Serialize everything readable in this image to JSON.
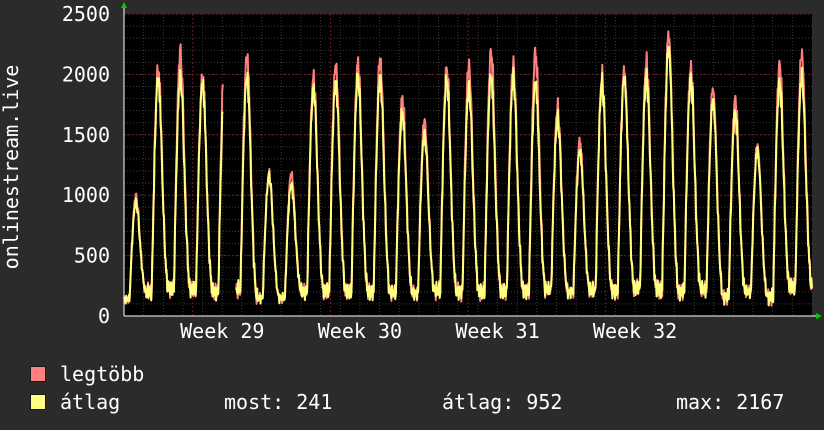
{
  "chart_data": {
    "type": "line",
    "ylabel": "onlinestream.live",
    "ylim": [
      0,
      2500
    ],
    "yticks": [
      0,
      500,
      1000,
      1500,
      2000,
      2500
    ],
    "x_range_days": [
      0,
      35
    ],
    "week_labels": [
      {
        "label": "Week 29",
        "day": 5
      },
      {
        "label": "Week 30",
        "day": 12
      },
      {
        "label": "Week 31",
        "day": 19
      },
      {
        "label": "Week 32",
        "day": 26
      }
    ],
    "grid": true,
    "background": "#000000",
    "grid_major_color": "#6b1d1d",
    "grid_minor_color": "#3a3a3a",
    "axis_arrow_color": "#00cc00",
    "gap_days": [
      [
        5.05,
        5.7
      ]
    ],
    "series": [
      {
        "name": "legtöbb",
        "color": "#ff7f7f",
        "peaks": [
          1000,
          2060,
          2200,
          2000,
          2200,
          2170,
          1180,
          1190,
          1980,
          2090,
          2100,
          2150,
          1810,
          1630,
          2060,
          2090,
          2200,
          2090,
          2200,
          1740,
          1460,
          2000,
          2050,
          2110,
          2350,
          2060,
          1900,
          1800,
          1430,
          2090,
          2190
        ],
        "troughs": [
          140,
          200,
          230,
          220,
          200,
          220,
          150,
          150,
          200,
          210,
          200,
          200,
          190,
          190,
          210,
          200,
          200,
          200,
          210,
          220,
          200,
          210,
          210,
          230,
          220,
          200,
          220,
          160,
          200,
          160,
          240
        ]
      },
      {
        "name": "átlag",
        "color": "#ffff80",
        "peaks": [
          950,
          1980,
          2000,
          1950,
          1980,
          2000,
          1180,
          1100,
          1900,
          1950,
          2000,
          1990,
          1700,
          1520,
          1980,
          1900,
          2000,
          1990,
          1950,
          1650,
          1380,
          1950,
          1990,
          2000,
          2250,
          1990,
          1800,
          1700,
          1380,
          1950,
          2000
        ],
        "troughs": [
          140,
          200,
          230,
          220,
          200,
          220,
          150,
          150,
          200,
          210,
          200,
          200,
          190,
          190,
          210,
          200,
          200,
          200,
          210,
          220,
          200,
          210,
          210,
          230,
          220,
          200,
          220,
          160,
          200,
          160,
          241
        ]
      }
    ]
  },
  "legend": {
    "max_label": "legtöbb",
    "avg_label": "átlag",
    "max_color": "#ff7f7f",
    "avg_color": "#ffff80"
  },
  "stats": {
    "current": "most: 241",
    "average": "átlag: 952",
    "maximum": "max: 2167"
  }
}
